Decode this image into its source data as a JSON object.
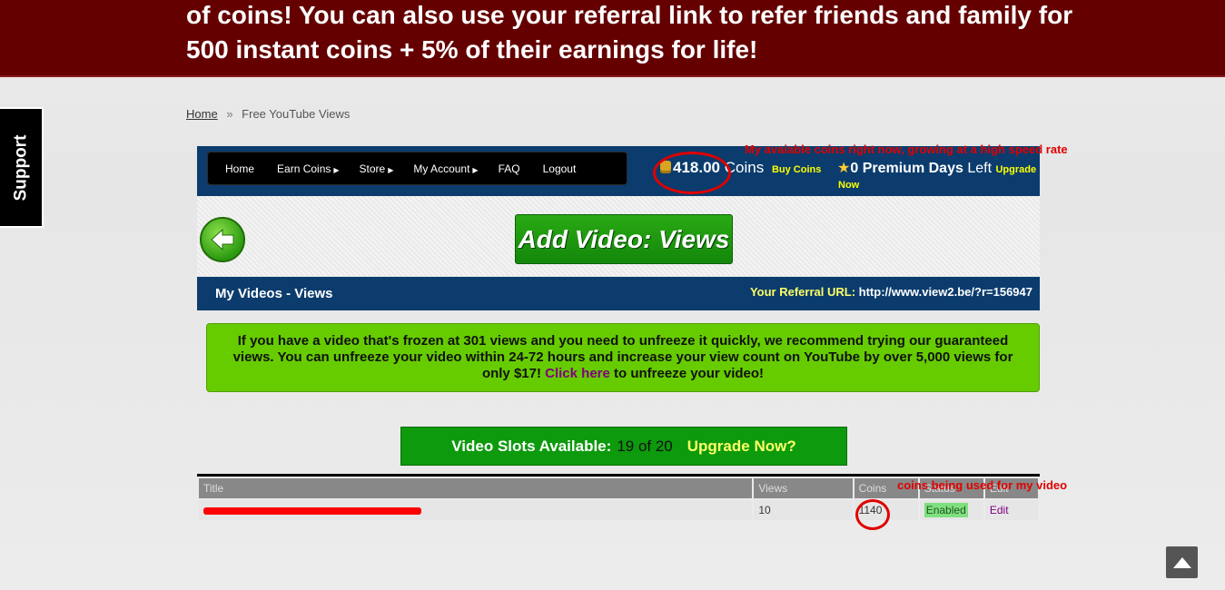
{
  "banner": {
    "text": "of coins! You can also use your referral link to refer friends and family for 500 instant coins + 5% of their earnings for life!"
  },
  "support_tab": {
    "label": "Support"
  },
  "breadcrumb": {
    "home": "Home",
    "separator": "»",
    "current": "Free YouTube Views"
  },
  "nav": {
    "items": [
      {
        "label": "Home",
        "caret": ""
      },
      {
        "label": "Earn Coins",
        "caret": "▶"
      },
      {
        "label": "Store",
        "caret": "▶"
      },
      {
        "label": "My Account",
        "caret": "▶"
      },
      {
        "label": "FAQ",
        "caret": ""
      },
      {
        "label": "Logout",
        "caret": ""
      }
    ],
    "coins_value": "418.00",
    "coins_label": "Coins",
    "buy_coins": "Buy Coins",
    "premium_value": "0",
    "premium_label": "Premium Days",
    "premium_left": "Left",
    "upgrade": "Upgrade",
    "upgrade_now": "Now"
  },
  "annotations": {
    "coins_note": "My avaiable coins right now, growing at a high speed rate",
    "video_note": "coins being used for my video"
  },
  "header": {
    "add_video_label": "Add Video: Views"
  },
  "videos_bar": {
    "title": "My Videos - Views",
    "ref_label": "Your Referral URL:",
    "ref_url": "http://www.view2.be/?r=156947"
  },
  "notice": {
    "text_before": "If you have a video that's frozen at 301 views and you need to unfreeze it quickly, we recommend trying our guaranteed views. You can unfreeze your video within 24-72 hours and increase your view count on YouTube by over 5,000 views for only $17!",
    "link": "Click here",
    "text_after": "to unfreeze your video!"
  },
  "slots": {
    "label": "Video Slots Available:",
    "count": "19 of 20",
    "upgrade": "Upgrade Now?"
  },
  "table": {
    "headers": [
      "Title",
      "Views",
      "Coins",
      "Status",
      "Edit"
    ],
    "rows": [
      {
        "views": "10",
        "coins": "1140",
        "status": "Enabled",
        "edit": "Edit"
      }
    ]
  },
  "colors": {
    "banner_bg": "#640000",
    "nav_bg": "#0b3c6d",
    "notice_bg": "#66cc00",
    "slots_bg": "#0d9a0d",
    "annotation_red": "#e00000"
  }
}
